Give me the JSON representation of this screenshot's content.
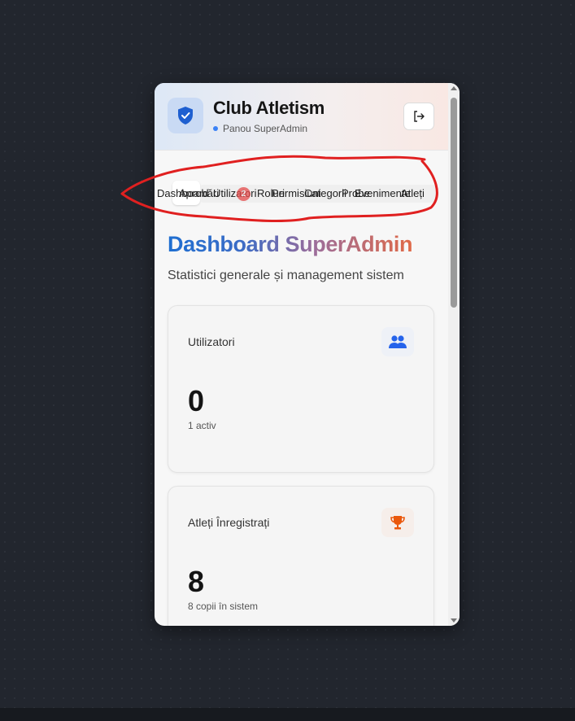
{
  "header": {
    "title": "Club Atletism",
    "subtitle": "Panou SuperAdmin",
    "logo_icon": "shield-check-icon",
    "logout_icon": "logout-icon"
  },
  "nav": {
    "items": [
      "Dashboard",
      "Aprobări",
      "Utilizatori",
      "Roluri",
      "Permisiuni",
      "Categorii",
      "Probe",
      "Evenimente",
      "Atleți"
    ],
    "badge": "2"
  },
  "page": {
    "title": "Dashboard SuperAdmin",
    "subtitle": "Statistici generale și management sistem"
  },
  "cards": [
    {
      "label": "Utilizatori",
      "value": "0",
      "note": "1 activ",
      "icon": "users-icon",
      "accent": "#2563eb"
    },
    {
      "label": "Atleți Înregistrați",
      "value": "8",
      "note": "8 copii în sistem",
      "icon": "trophy-icon",
      "accent": "#ea580c"
    }
  ],
  "colors": {
    "title_gradient": [
      "#1f6fd1",
      "#9c6d9a",
      "#e06a48"
    ],
    "annotation": "#e02020"
  }
}
